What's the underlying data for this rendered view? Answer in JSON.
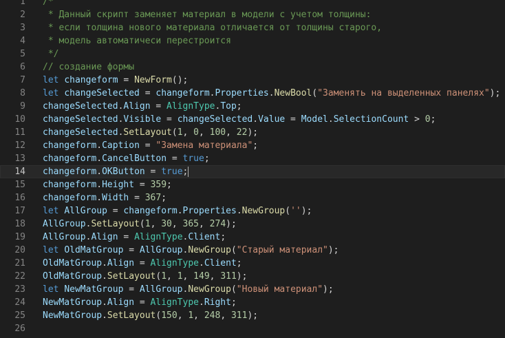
{
  "editor": {
    "current_line": 14,
    "lines": [
      {
        "n": "1",
        "tokens": [
          {
            "t": "/*",
            "c": "cmt"
          }
        ]
      },
      {
        "n": "2",
        "tokens": [
          {
            "t": " * Данный скрипт заменяет материал в модели с учетом толщины:",
            "c": "cmt"
          }
        ]
      },
      {
        "n": "3",
        "tokens": [
          {
            "t": " * если толщина нового материала отличается от толщины старого,",
            "c": "cmt"
          }
        ]
      },
      {
        "n": "4",
        "tokens": [
          {
            "t": " * модель автоматичеси перестроится",
            "c": "cmt"
          }
        ]
      },
      {
        "n": "5",
        "tokens": [
          {
            "t": " */",
            "c": "cmt"
          }
        ]
      },
      {
        "n": "6",
        "tokens": [
          {
            "t": "// создание формы",
            "c": "cmt"
          }
        ]
      },
      {
        "n": "7",
        "tokens": [
          {
            "t": "let",
            "c": "kw"
          },
          {
            "t": " ",
            "c": "pl"
          },
          {
            "t": "changeform",
            "c": "var"
          },
          {
            "t": " = ",
            "c": "pl"
          },
          {
            "t": "NewForm",
            "c": "fn"
          },
          {
            "t": "();",
            "c": "pl"
          }
        ]
      },
      {
        "n": "8",
        "tokens": [
          {
            "t": "let",
            "c": "kw"
          },
          {
            "t": " ",
            "c": "pl"
          },
          {
            "t": "changeSelected",
            "c": "var"
          },
          {
            "t": " = ",
            "c": "pl"
          },
          {
            "t": "changeform",
            "c": "var"
          },
          {
            "t": ".",
            "c": "pl"
          },
          {
            "t": "Properties",
            "c": "var"
          },
          {
            "t": ".",
            "c": "pl"
          },
          {
            "t": "NewBool",
            "c": "fn"
          },
          {
            "t": "(",
            "c": "pl"
          },
          {
            "t": "\"Заменять на выделенных панелях\"",
            "c": "str"
          },
          {
            "t": ");",
            "c": "pl"
          }
        ]
      },
      {
        "n": "9",
        "tokens": [
          {
            "t": "changeSelected",
            "c": "var"
          },
          {
            "t": ".",
            "c": "pl"
          },
          {
            "t": "Align",
            "c": "var"
          },
          {
            "t": " = ",
            "c": "pl"
          },
          {
            "t": "AlignType",
            "c": "type"
          },
          {
            "t": ".",
            "c": "pl"
          },
          {
            "t": "Top",
            "c": "var"
          },
          {
            "t": ";",
            "c": "pl"
          }
        ]
      },
      {
        "n": "10",
        "tokens": [
          {
            "t": "changeSelected",
            "c": "var"
          },
          {
            "t": ".",
            "c": "pl"
          },
          {
            "t": "Visible",
            "c": "var"
          },
          {
            "t": " = ",
            "c": "pl"
          },
          {
            "t": "changeSelected",
            "c": "var"
          },
          {
            "t": ".",
            "c": "pl"
          },
          {
            "t": "Value",
            "c": "var"
          },
          {
            "t": " = ",
            "c": "pl"
          },
          {
            "t": "Model",
            "c": "var"
          },
          {
            "t": ".",
            "c": "pl"
          },
          {
            "t": "SelectionCount",
            "c": "var"
          },
          {
            "t": " > ",
            "c": "pl"
          },
          {
            "t": "0",
            "c": "num"
          },
          {
            "t": ";",
            "c": "pl"
          }
        ]
      },
      {
        "n": "11",
        "tokens": [
          {
            "t": "changeSelected",
            "c": "var"
          },
          {
            "t": ".",
            "c": "pl"
          },
          {
            "t": "SetLayout",
            "c": "fn"
          },
          {
            "t": "(",
            "c": "pl"
          },
          {
            "t": "1",
            "c": "num"
          },
          {
            "t": ", ",
            "c": "pl"
          },
          {
            "t": "0",
            "c": "num"
          },
          {
            "t": ", ",
            "c": "pl"
          },
          {
            "t": "100",
            "c": "num"
          },
          {
            "t": ", ",
            "c": "pl"
          },
          {
            "t": "22",
            "c": "num"
          },
          {
            "t": ");",
            "c": "pl"
          }
        ]
      },
      {
        "n": "12",
        "tokens": [
          {
            "t": "changeform",
            "c": "var"
          },
          {
            "t": ".",
            "c": "pl"
          },
          {
            "t": "Caption",
            "c": "var"
          },
          {
            "t": " = ",
            "c": "pl"
          },
          {
            "t": "\"Замена материала\"",
            "c": "str"
          },
          {
            "t": ";",
            "c": "pl"
          }
        ]
      },
      {
        "n": "13",
        "tokens": [
          {
            "t": "changeform",
            "c": "var"
          },
          {
            "t": ".",
            "c": "pl"
          },
          {
            "t": "CancelButton",
            "c": "var"
          },
          {
            "t": " = ",
            "c": "pl"
          },
          {
            "t": "true",
            "c": "kw"
          },
          {
            "t": ";",
            "c": "pl"
          }
        ]
      },
      {
        "n": "14",
        "tokens": [
          {
            "t": "changeform",
            "c": "var"
          },
          {
            "t": ".",
            "c": "pl"
          },
          {
            "t": "OKButton",
            "c": "var"
          },
          {
            "t": " = ",
            "c": "pl"
          },
          {
            "t": "true",
            "c": "kw"
          },
          {
            "t": ";",
            "c": "pl"
          }
        ]
      },
      {
        "n": "15",
        "tokens": [
          {
            "t": "changeform",
            "c": "var"
          },
          {
            "t": ".",
            "c": "pl"
          },
          {
            "t": "Height",
            "c": "var"
          },
          {
            "t": " = ",
            "c": "pl"
          },
          {
            "t": "359",
            "c": "num"
          },
          {
            "t": ";",
            "c": "pl"
          }
        ]
      },
      {
        "n": "16",
        "tokens": [
          {
            "t": "changeform",
            "c": "var"
          },
          {
            "t": ".",
            "c": "pl"
          },
          {
            "t": "Width",
            "c": "var"
          },
          {
            "t": " = ",
            "c": "pl"
          },
          {
            "t": "367",
            "c": "num"
          },
          {
            "t": ";",
            "c": "pl"
          }
        ]
      },
      {
        "n": "17",
        "tokens": [
          {
            "t": "let",
            "c": "kw"
          },
          {
            "t": " ",
            "c": "pl"
          },
          {
            "t": "AllGroup",
            "c": "var"
          },
          {
            "t": " = ",
            "c": "pl"
          },
          {
            "t": "changeform",
            "c": "var"
          },
          {
            "t": ".",
            "c": "pl"
          },
          {
            "t": "Properties",
            "c": "var"
          },
          {
            "t": ".",
            "c": "pl"
          },
          {
            "t": "NewGroup",
            "c": "fn"
          },
          {
            "t": "(",
            "c": "pl"
          },
          {
            "t": "''",
            "c": "str"
          },
          {
            "t": ");",
            "c": "pl"
          }
        ]
      },
      {
        "n": "18",
        "tokens": [
          {
            "t": "AllGroup",
            "c": "var"
          },
          {
            "t": ".",
            "c": "pl"
          },
          {
            "t": "SetLayout",
            "c": "fn"
          },
          {
            "t": "(",
            "c": "pl"
          },
          {
            "t": "1",
            "c": "num"
          },
          {
            "t": ", ",
            "c": "pl"
          },
          {
            "t": "30",
            "c": "num"
          },
          {
            "t": ", ",
            "c": "pl"
          },
          {
            "t": "365",
            "c": "num"
          },
          {
            "t": ", ",
            "c": "pl"
          },
          {
            "t": "274",
            "c": "num"
          },
          {
            "t": ");",
            "c": "pl"
          }
        ]
      },
      {
        "n": "19",
        "tokens": [
          {
            "t": "AllGroup",
            "c": "var"
          },
          {
            "t": ".",
            "c": "pl"
          },
          {
            "t": "Align",
            "c": "var"
          },
          {
            "t": " = ",
            "c": "pl"
          },
          {
            "t": "AlignType",
            "c": "type"
          },
          {
            "t": ".",
            "c": "pl"
          },
          {
            "t": "Client",
            "c": "var"
          },
          {
            "t": ";",
            "c": "pl"
          }
        ]
      },
      {
        "n": "20",
        "tokens": [
          {
            "t": "let",
            "c": "kw"
          },
          {
            "t": " ",
            "c": "pl"
          },
          {
            "t": "OldMatGroup",
            "c": "var"
          },
          {
            "t": " = ",
            "c": "pl"
          },
          {
            "t": "AllGroup",
            "c": "var"
          },
          {
            "t": ".",
            "c": "pl"
          },
          {
            "t": "NewGroup",
            "c": "fn"
          },
          {
            "t": "(",
            "c": "pl"
          },
          {
            "t": "\"Старый материал\"",
            "c": "str"
          },
          {
            "t": ");",
            "c": "pl"
          }
        ]
      },
      {
        "n": "21",
        "tokens": [
          {
            "t": "OldMatGroup",
            "c": "var"
          },
          {
            "t": ".",
            "c": "pl"
          },
          {
            "t": "Align",
            "c": "var"
          },
          {
            "t": " = ",
            "c": "pl"
          },
          {
            "t": "AlignType",
            "c": "type"
          },
          {
            "t": ".",
            "c": "pl"
          },
          {
            "t": "Client",
            "c": "var"
          },
          {
            "t": ";",
            "c": "pl"
          }
        ]
      },
      {
        "n": "22",
        "tokens": [
          {
            "t": "OldMatGroup",
            "c": "var"
          },
          {
            "t": ".",
            "c": "pl"
          },
          {
            "t": "SetLayout",
            "c": "fn"
          },
          {
            "t": "(",
            "c": "pl"
          },
          {
            "t": "1",
            "c": "num"
          },
          {
            "t": ", ",
            "c": "pl"
          },
          {
            "t": "1",
            "c": "num"
          },
          {
            "t": ", ",
            "c": "pl"
          },
          {
            "t": "149",
            "c": "num"
          },
          {
            "t": ", ",
            "c": "pl"
          },
          {
            "t": "311",
            "c": "num"
          },
          {
            "t": ");",
            "c": "pl"
          }
        ]
      },
      {
        "n": "23",
        "tokens": [
          {
            "t": "let",
            "c": "kw"
          },
          {
            "t": " ",
            "c": "pl"
          },
          {
            "t": "NewMatGroup",
            "c": "var"
          },
          {
            "t": " = ",
            "c": "pl"
          },
          {
            "t": "AllGroup",
            "c": "var"
          },
          {
            "t": ".",
            "c": "pl"
          },
          {
            "t": "NewGroup",
            "c": "fn"
          },
          {
            "t": "(",
            "c": "pl"
          },
          {
            "t": "\"Новый материал\"",
            "c": "str"
          },
          {
            "t": ");",
            "c": "pl"
          }
        ]
      },
      {
        "n": "24",
        "tokens": [
          {
            "t": "NewMatGroup",
            "c": "var"
          },
          {
            "t": ".",
            "c": "pl"
          },
          {
            "t": "Align",
            "c": "var"
          },
          {
            "t": " = ",
            "c": "pl"
          },
          {
            "t": "AlignType",
            "c": "type"
          },
          {
            "t": ".",
            "c": "pl"
          },
          {
            "t": "Right",
            "c": "var"
          },
          {
            "t": ";",
            "c": "pl"
          }
        ]
      },
      {
        "n": "25",
        "tokens": [
          {
            "t": "NewMatGroup",
            "c": "var"
          },
          {
            "t": ".",
            "c": "pl"
          },
          {
            "t": "SetLayout",
            "c": "fn"
          },
          {
            "t": "(",
            "c": "pl"
          },
          {
            "t": "150",
            "c": "num"
          },
          {
            "t": ", ",
            "c": "pl"
          },
          {
            "t": "1",
            "c": "num"
          },
          {
            "t": ", ",
            "c": "pl"
          },
          {
            "t": "248",
            "c": "num"
          },
          {
            "t": ", ",
            "c": "pl"
          },
          {
            "t": "311",
            "c": "num"
          },
          {
            "t": ");",
            "c": "pl"
          }
        ]
      },
      {
        "n": "26",
        "tokens": []
      }
    ]
  }
}
